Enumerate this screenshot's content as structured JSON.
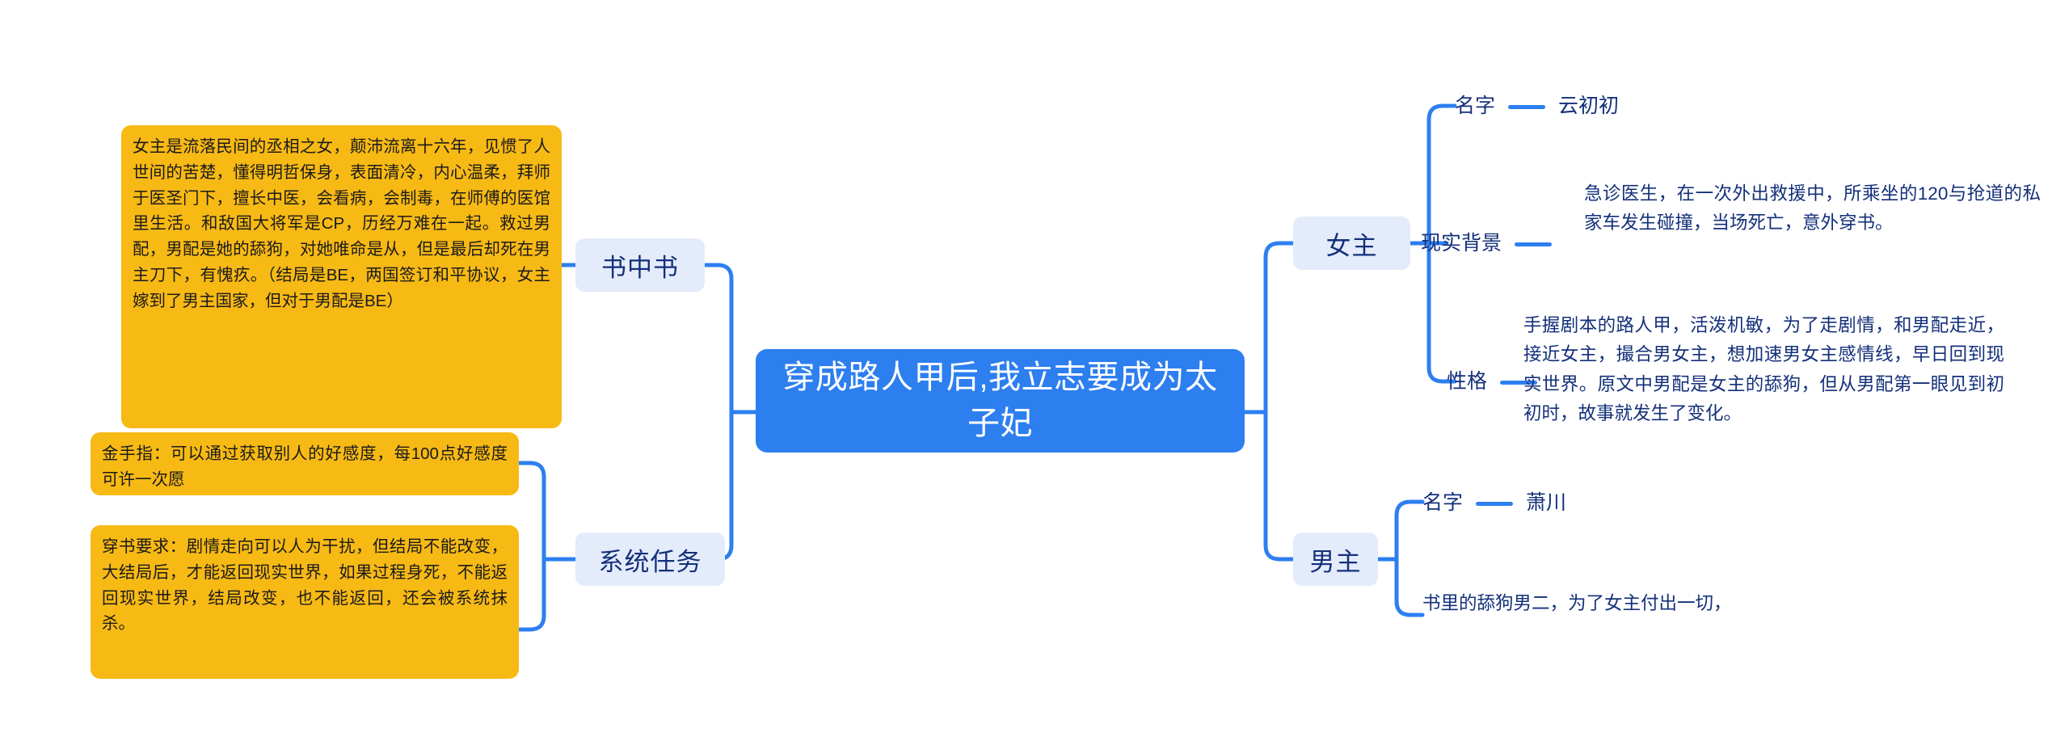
{
  "document": {
    "type": "mind-map",
    "title": "穿成路人甲后,我立志要成为太子妃",
    "background_color": "#ffffff"
  },
  "colors": {
    "root_fill": "#2d7ff0",
    "root_text": "#ffffff",
    "branch_fill": "#e4ecfb",
    "branch_text": "#14307a",
    "note_fill": "#f7b914",
    "note_text": "#1b1b1b",
    "link_stroke": "#2d7ff0",
    "leaf_text": "#14307a"
  },
  "root": {
    "label": "穿成路人甲后,我立志要成为太子妃"
  },
  "left_branches": [
    {
      "id": "book-in-book",
      "label": "书中书",
      "notes": [
        {
          "id": "heroine-note",
          "text": "女主是流落民间的丞相之女，颠沛流离十六年，见惯了人世间的苦楚，懂得明哲保身，表面清冷，内心温柔，拜师于医圣门下，擅长中医，会看病，会制毒，在师傅的医馆里生活。和敌国大将军是CP，历经万难在一起。救过男配，男配是她的舔狗，对她唯命是从，但是最后却死在男主刀下，有愧疚。（结局是BE，两国签订和平协议，女主嫁到了男主国家，但对于男配是BE）"
        }
      ]
    },
    {
      "id": "system-task",
      "label": "系统任务",
      "notes": [
        {
          "id": "golden-finger-note",
          "text": "金手指：可以通过获取别人的好感度，每100点好感度可许一次愿"
        },
        {
          "id": "transmigration-rule-note",
          "text": "穿书要求：剧情走向可以人为干扰，但结局不能改变，大结局后，才能返回现实世界，如果过程身死，不能返回现实世界，结局改变，也不能返回，还会被系统抹杀。"
        }
      ]
    }
  ],
  "right_branches": [
    {
      "id": "heroine",
      "label": "女主",
      "leaves": [
        {
          "id": "heroine-name",
          "label": "名字",
          "has_dash": true,
          "value": "云初初"
        },
        {
          "id": "heroine-reality-background",
          "label": "现实背景",
          "has_dash": true,
          "value": "急诊医生，在一次外出救援中，所乘坐的120与抢道的私家车发生碰撞，当场死亡，意外穿书。"
        },
        {
          "id": "heroine-personality",
          "label": "性格",
          "has_dash": true,
          "value": "手握剧本的路人甲，活泼机敏，为了走剧情，和男配走近，接近女主，撮合男女主，想加速男女主感情线，早日回到现实世界。原文中男配是女主的舔狗，但从男配第一眼见到初初时，故事就发生了变化。"
        }
      ]
    },
    {
      "id": "hero",
      "label": "男主",
      "leaves": [
        {
          "id": "hero-name",
          "label": "名字",
          "has_dash": true,
          "value": "萧川"
        },
        {
          "id": "hero-description",
          "label": "",
          "has_dash": false,
          "value": "书里的舔狗男二，为了女主付出一切，"
        }
      ]
    }
  ]
}
